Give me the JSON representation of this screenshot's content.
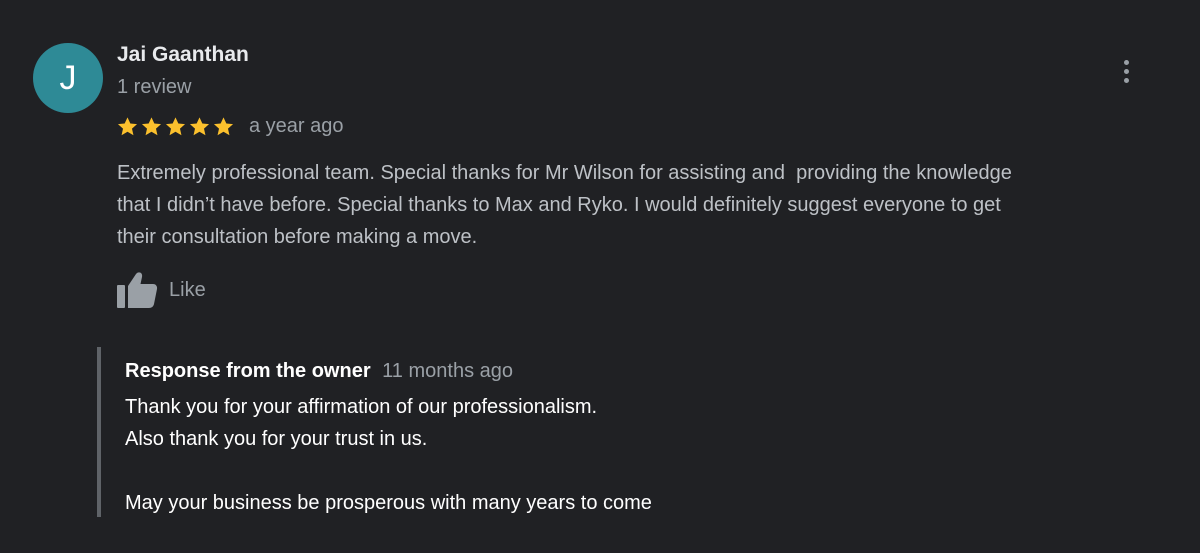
{
  "reviewer": {
    "avatar_letter": "J",
    "avatar_color": "#2e8a96",
    "name": "Jai Gaanthan",
    "review_count": "1 review"
  },
  "review": {
    "rating": 5,
    "rating_max": 5,
    "star_color": "#fbc02d",
    "time": "a year ago",
    "text_lines": [
      "Extremely professional team. Special thanks for Mr Wilson for assisting and  providing the knowledge",
      "that I didn’t have before. Special thanks to Max and Ryko. I would definitely suggest everyone to get",
      "their consultation before making a move."
    ]
  },
  "actions": {
    "like_label": "Like",
    "like_icon": "thumbs-up-icon",
    "more_icon": "more-vert-icon"
  },
  "owner_response": {
    "title": "Response from the owner",
    "time": "11 months ago",
    "text_lines": [
      "Thank you for your affirmation of our professionalism.",
      "Also thank you for your trust in us.",
      "",
      "May your business be prosperous with many years to come"
    ]
  }
}
